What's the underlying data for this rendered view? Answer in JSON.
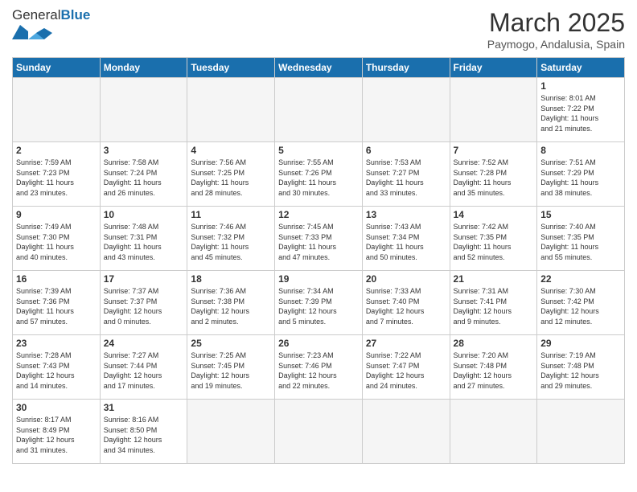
{
  "header": {
    "logo_text_normal": "General",
    "logo_text_bold": "Blue",
    "month_year": "March 2025",
    "location": "Paymogo, Andalusia, Spain"
  },
  "weekdays": [
    "Sunday",
    "Monday",
    "Tuesday",
    "Wednesday",
    "Thursday",
    "Friday",
    "Saturday"
  ],
  "weeks": [
    [
      {
        "day": "",
        "empty": true
      },
      {
        "day": "",
        "empty": true
      },
      {
        "day": "",
        "empty": true
      },
      {
        "day": "",
        "empty": true
      },
      {
        "day": "",
        "empty": true
      },
      {
        "day": "",
        "empty": true
      },
      {
        "day": "1",
        "info": "Sunrise: 8:01 AM\nSunset: 7:22 PM\nDaylight: 11 hours\nand 21 minutes."
      }
    ],
    [
      {
        "day": "2",
        "info": "Sunrise: 7:59 AM\nSunset: 7:23 PM\nDaylight: 11 hours\nand 23 minutes."
      },
      {
        "day": "3",
        "info": "Sunrise: 7:58 AM\nSunset: 7:24 PM\nDaylight: 11 hours\nand 26 minutes."
      },
      {
        "day": "4",
        "info": "Sunrise: 7:56 AM\nSunset: 7:25 PM\nDaylight: 11 hours\nand 28 minutes."
      },
      {
        "day": "5",
        "info": "Sunrise: 7:55 AM\nSunset: 7:26 PM\nDaylight: 11 hours\nand 30 minutes."
      },
      {
        "day": "6",
        "info": "Sunrise: 7:53 AM\nSunset: 7:27 PM\nDaylight: 11 hours\nand 33 minutes."
      },
      {
        "day": "7",
        "info": "Sunrise: 7:52 AM\nSunset: 7:28 PM\nDaylight: 11 hours\nand 35 minutes."
      },
      {
        "day": "8",
        "info": "Sunrise: 7:51 AM\nSunset: 7:29 PM\nDaylight: 11 hours\nand 38 minutes."
      }
    ],
    [
      {
        "day": "9",
        "info": "Sunrise: 7:49 AM\nSunset: 7:30 PM\nDaylight: 11 hours\nand 40 minutes."
      },
      {
        "day": "10",
        "info": "Sunrise: 7:48 AM\nSunset: 7:31 PM\nDaylight: 11 hours\nand 43 minutes."
      },
      {
        "day": "11",
        "info": "Sunrise: 7:46 AM\nSunset: 7:32 PM\nDaylight: 11 hours\nand 45 minutes."
      },
      {
        "day": "12",
        "info": "Sunrise: 7:45 AM\nSunset: 7:33 PM\nDaylight: 11 hours\nand 47 minutes."
      },
      {
        "day": "13",
        "info": "Sunrise: 7:43 AM\nSunset: 7:34 PM\nDaylight: 11 hours\nand 50 minutes."
      },
      {
        "day": "14",
        "info": "Sunrise: 7:42 AM\nSunset: 7:35 PM\nDaylight: 11 hours\nand 52 minutes."
      },
      {
        "day": "15",
        "info": "Sunrise: 7:40 AM\nSunset: 7:35 PM\nDaylight: 11 hours\nand 55 minutes."
      }
    ],
    [
      {
        "day": "16",
        "info": "Sunrise: 7:39 AM\nSunset: 7:36 PM\nDaylight: 11 hours\nand 57 minutes."
      },
      {
        "day": "17",
        "info": "Sunrise: 7:37 AM\nSunset: 7:37 PM\nDaylight: 12 hours\nand 0 minutes."
      },
      {
        "day": "18",
        "info": "Sunrise: 7:36 AM\nSunset: 7:38 PM\nDaylight: 12 hours\nand 2 minutes."
      },
      {
        "day": "19",
        "info": "Sunrise: 7:34 AM\nSunset: 7:39 PM\nDaylight: 12 hours\nand 5 minutes."
      },
      {
        "day": "20",
        "info": "Sunrise: 7:33 AM\nSunset: 7:40 PM\nDaylight: 12 hours\nand 7 minutes."
      },
      {
        "day": "21",
        "info": "Sunrise: 7:31 AM\nSunset: 7:41 PM\nDaylight: 12 hours\nand 9 minutes."
      },
      {
        "day": "22",
        "info": "Sunrise: 7:30 AM\nSunset: 7:42 PM\nDaylight: 12 hours\nand 12 minutes."
      }
    ],
    [
      {
        "day": "23",
        "info": "Sunrise: 7:28 AM\nSunset: 7:43 PM\nDaylight: 12 hours\nand 14 minutes."
      },
      {
        "day": "24",
        "info": "Sunrise: 7:27 AM\nSunset: 7:44 PM\nDaylight: 12 hours\nand 17 minutes."
      },
      {
        "day": "25",
        "info": "Sunrise: 7:25 AM\nSunset: 7:45 PM\nDaylight: 12 hours\nand 19 minutes."
      },
      {
        "day": "26",
        "info": "Sunrise: 7:23 AM\nSunset: 7:46 PM\nDaylight: 12 hours\nand 22 minutes."
      },
      {
        "day": "27",
        "info": "Sunrise: 7:22 AM\nSunset: 7:47 PM\nDaylight: 12 hours\nand 24 minutes."
      },
      {
        "day": "28",
        "info": "Sunrise: 7:20 AM\nSunset: 7:48 PM\nDaylight: 12 hours\nand 27 minutes."
      },
      {
        "day": "29",
        "info": "Sunrise: 7:19 AM\nSunset: 7:48 PM\nDaylight: 12 hours\nand 29 minutes."
      }
    ],
    [
      {
        "day": "30",
        "info": "Sunrise: 8:17 AM\nSunset: 8:49 PM\nDaylight: 12 hours\nand 31 minutes."
      },
      {
        "day": "31",
        "info": "Sunrise: 8:16 AM\nSunset: 8:50 PM\nDaylight: 12 hours\nand 34 minutes."
      },
      {
        "day": "",
        "empty": true
      },
      {
        "day": "",
        "empty": true
      },
      {
        "day": "",
        "empty": true
      },
      {
        "day": "",
        "empty": true
      },
      {
        "day": "",
        "empty": true
      }
    ]
  ]
}
